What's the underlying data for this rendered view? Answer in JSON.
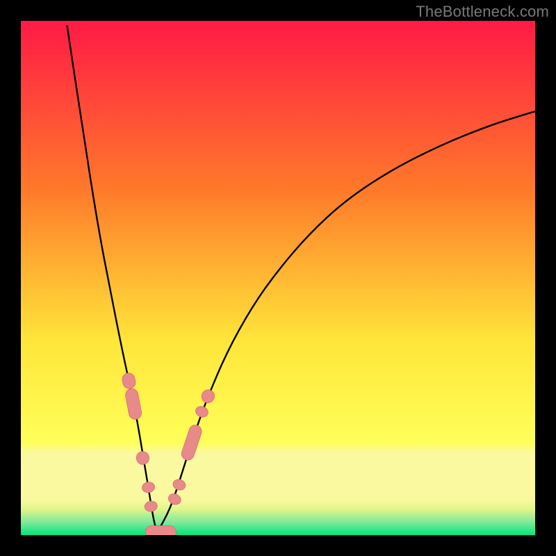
{
  "watermark": "TheBottleneck.com",
  "colors": {
    "frame_bg": "#000000",
    "gradient_top": "#ff1a46",
    "gradient_mid1": "#ff7a2a",
    "gradient_mid2": "#ffe53a",
    "gradient_band_light": "#fbf9a0",
    "gradient_bottom": "#00e57a",
    "curve": "#000000",
    "marker_fill": "#e88a8a",
    "marker_stroke": "#d77474"
  },
  "chart_data": {
    "type": "line",
    "title": "",
    "xlabel": "",
    "ylabel": "",
    "xlim": [
      0,
      1
    ],
    "ylim": [
      0,
      1
    ],
    "note": "V-shaped bottleneck curve on rainbow gradient. x normalized 0..1 left→right; y normalized 0..1 bottom→top. Minimum near x≈0.265 at y≈0 (green). Left branch rises sharply toward y=1 at x≈0.09; right branch rises slowly toward y≈0.82 at x=1.",
    "series": [
      {
        "name": "left-branch",
        "x": [
          0.09,
          0.12,
          0.15,
          0.175,
          0.195,
          0.21,
          0.225,
          0.24,
          0.25,
          0.258,
          0.265
        ],
        "values": [
          0.99,
          0.79,
          0.6,
          0.47,
          0.37,
          0.3,
          0.23,
          0.14,
          0.08,
          0.03,
          0.005
        ]
      },
      {
        "name": "right-branch",
        "x": [
          0.265,
          0.29,
          0.31,
          0.335,
          0.36,
          0.4,
          0.45,
          0.5,
          0.56,
          0.63,
          0.72,
          0.82,
          0.91,
          0.97,
          1.0
        ],
        "values": [
          0.005,
          0.05,
          0.11,
          0.19,
          0.26,
          0.355,
          0.445,
          0.515,
          0.585,
          0.65,
          0.71,
          0.76,
          0.796,
          0.815,
          0.824
        ]
      }
    ],
    "markers": {
      "name": "highlighted-points",
      "shape": "capsule",
      "points": [
        {
          "x": 0.21,
          "y": 0.3,
          "len": 0.03,
          "along": "left"
        },
        {
          "x": 0.219,
          "y": 0.255,
          "len": 0.06,
          "along": "left"
        },
        {
          "x": 0.237,
          "y": 0.15,
          "len": 0.025,
          "along": "left"
        },
        {
          "x": 0.248,
          "y": 0.093,
          "len": 0.02,
          "along": "left"
        },
        {
          "x": 0.253,
          "y": 0.056,
          "len": 0.02,
          "along": "left"
        },
        {
          "x": 0.272,
          "y": 0.006,
          "len": 0.06,
          "along": "flat"
        },
        {
          "x": 0.299,
          "y": 0.07,
          "len": 0.02,
          "along": "right"
        },
        {
          "x": 0.308,
          "y": 0.098,
          "len": 0.02,
          "along": "right"
        },
        {
          "x": 0.332,
          "y": 0.18,
          "len": 0.07,
          "along": "right"
        },
        {
          "x": 0.352,
          "y": 0.24,
          "len": 0.02,
          "along": "right"
        },
        {
          "x": 0.364,
          "y": 0.27,
          "len": 0.025,
          "along": "right"
        }
      ]
    }
  }
}
